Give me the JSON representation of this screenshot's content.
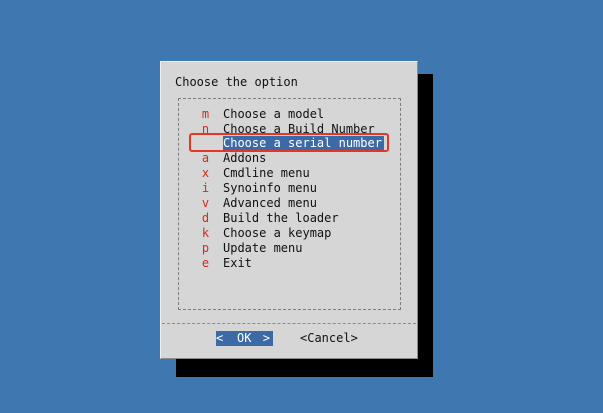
{
  "dialog": {
    "title": "Choose the option"
  },
  "menu": {
    "items": [
      {
        "key": "m",
        "label": "Choose a model"
      },
      {
        "key": "n",
        "label": "Choose a Build Number"
      },
      {
        "key": "",
        "label": "Choose a serial number"
      },
      {
        "key": "a",
        "label": "Addons"
      },
      {
        "key": "x",
        "label": "Cmdline menu"
      },
      {
        "key": "i",
        "label": "Synoinfo menu"
      },
      {
        "key": "v",
        "label": "Advanced menu"
      },
      {
        "key": "d",
        "label": "Build the loader"
      },
      {
        "key": "k",
        "label": "Choose a keymap"
      },
      {
        "key": "p",
        "label": "Update menu"
      },
      {
        "key": "e",
        "label": "Exit"
      }
    ]
  },
  "buttons": {
    "ok_left": "<",
    "ok": "OK",
    "ok_right": ">",
    "cancel": "<Cancel>"
  },
  "colors": {
    "background": "#3f77b1",
    "dialog": "#d6d6d6",
    "selection": "#3c6aa6",
    "hotkey": "#d22c18",
    "annotation": "#e53625"
  }
}
